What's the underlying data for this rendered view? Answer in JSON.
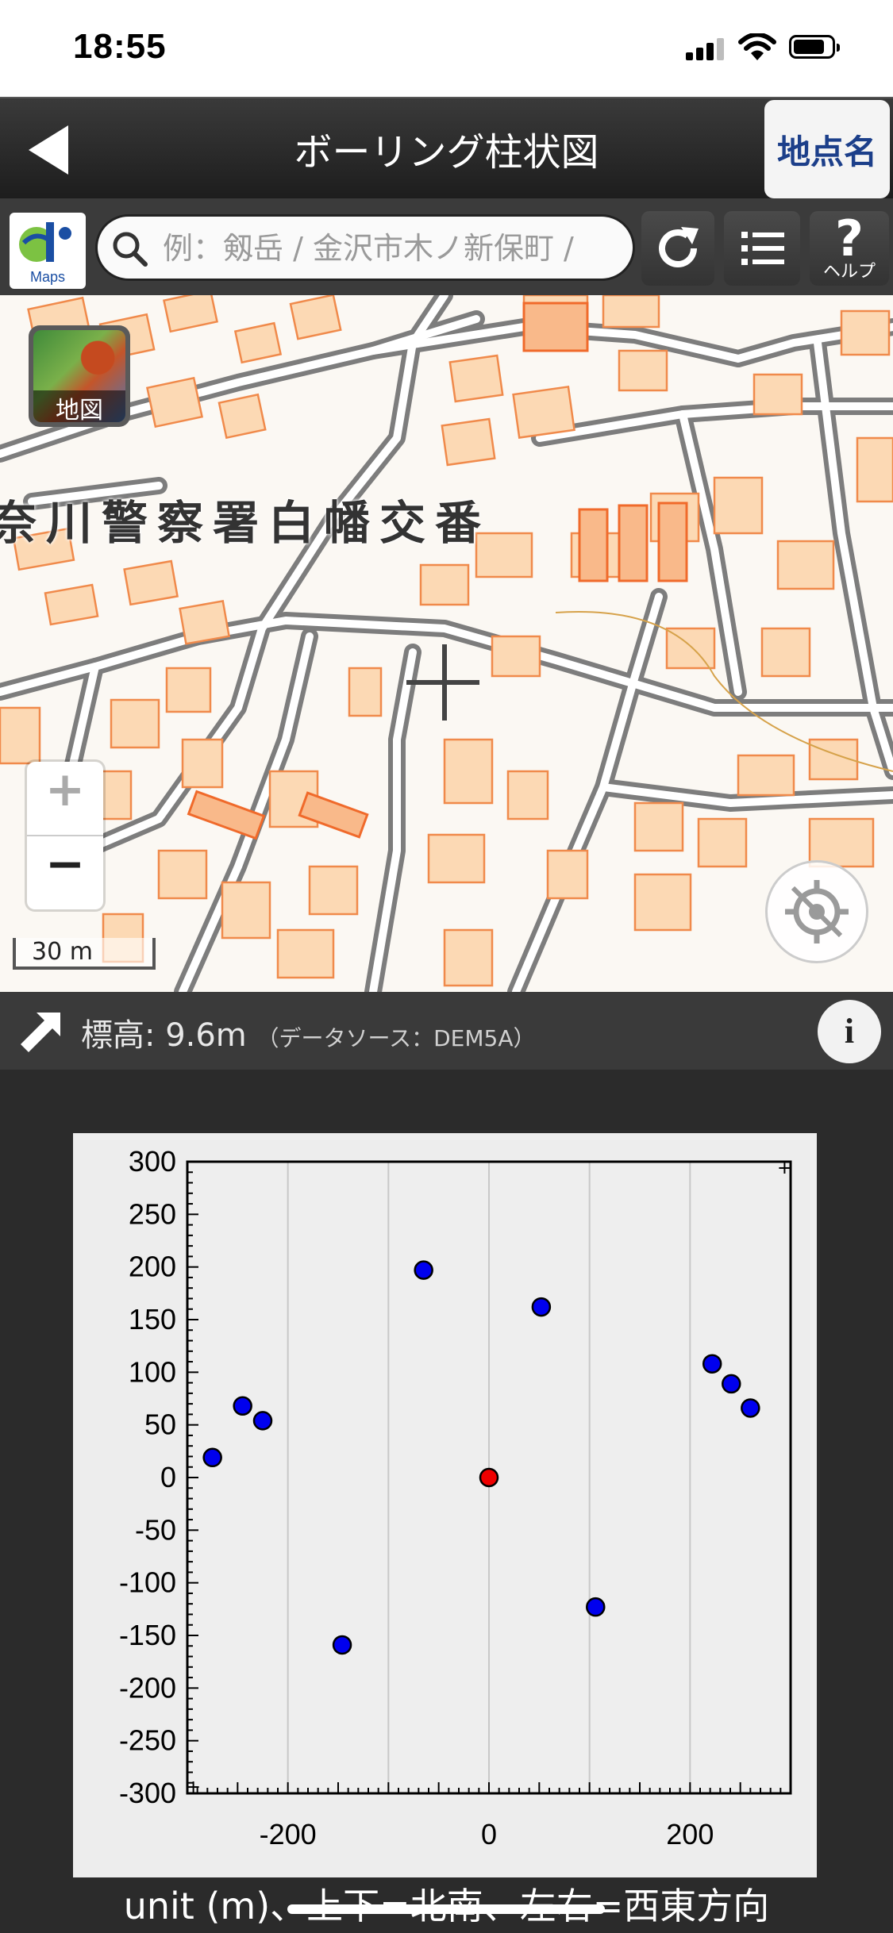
{
  "status_bar": {
    "time": "18:55"
  },
  "nav": {
    "title": "ボーリング柱状図",
    "place_button": "地点名"
  },
  "toolbar": {
    "search_placeholder": "例：剱岳 / 金沢市木ノ新保町 /",
    "logo_text": "Maps",
    "help_label": "ヘルプ",
    "icons": [
      "search-icon",
      "refresh-icon",
      "list-icon",
      "help-icon"
    ]
  },
  "map": {
    "place_label": "奈川警察署白幡交番",
    "layer_button_label": "地図",
    "zoom_in": "+",
    "zoom_out": "−",
    "scale_label": "30 m",
    "colors": {
      "building_fill": "#fcd9b4",
      "building_stroke": "#f08a4b",
      "road": "#777777",
      "background": "#fbf8f3"
    }
  },
  "elevation": {
    "label": "標高: 9.6m",
    "source": "（データソース：DEM5A）",
    "info_button": "i"
  },
  "chart_data": {
    "type": "scatter",
    "title": "",
    "xlim": [
      -300,
      300
    ],
    "ylim": [
      -300,
      300
    ],
    "x_ticks": [
      -200,
      0,
      200
    ],
    "y_ticks": [
      300,
      250,
      200,
      150,
      100,
      50,
      0,
      -50,
      -100,
      -150,
      -200,
      -250,
      -300
    ],
    "grid": true,
    "series": [
      {
        "color": "#0000ee",
        "points": [
          [
            -65,
            197
          ],
          [
            52,
            162
          ],
          [
            -245,
            68
          ],
          [
            -225,
            54
          ],
          [
            -275,
            19
          ],
          [
            222,
            108
          ],
          [
            241,
            89
          ],
          [
            260,
            66
          ],
          [
            106,
            -123
          ],
          [
            -146,
            -159
          ]
        ]
      },
      {
        "color": "#ee0000",
        "points": [
          [
            0,
            0
          ]
        ]
      }
    ]
  },
  "caption": "unit (m)、上下=北南、左右=西東方向"
}
